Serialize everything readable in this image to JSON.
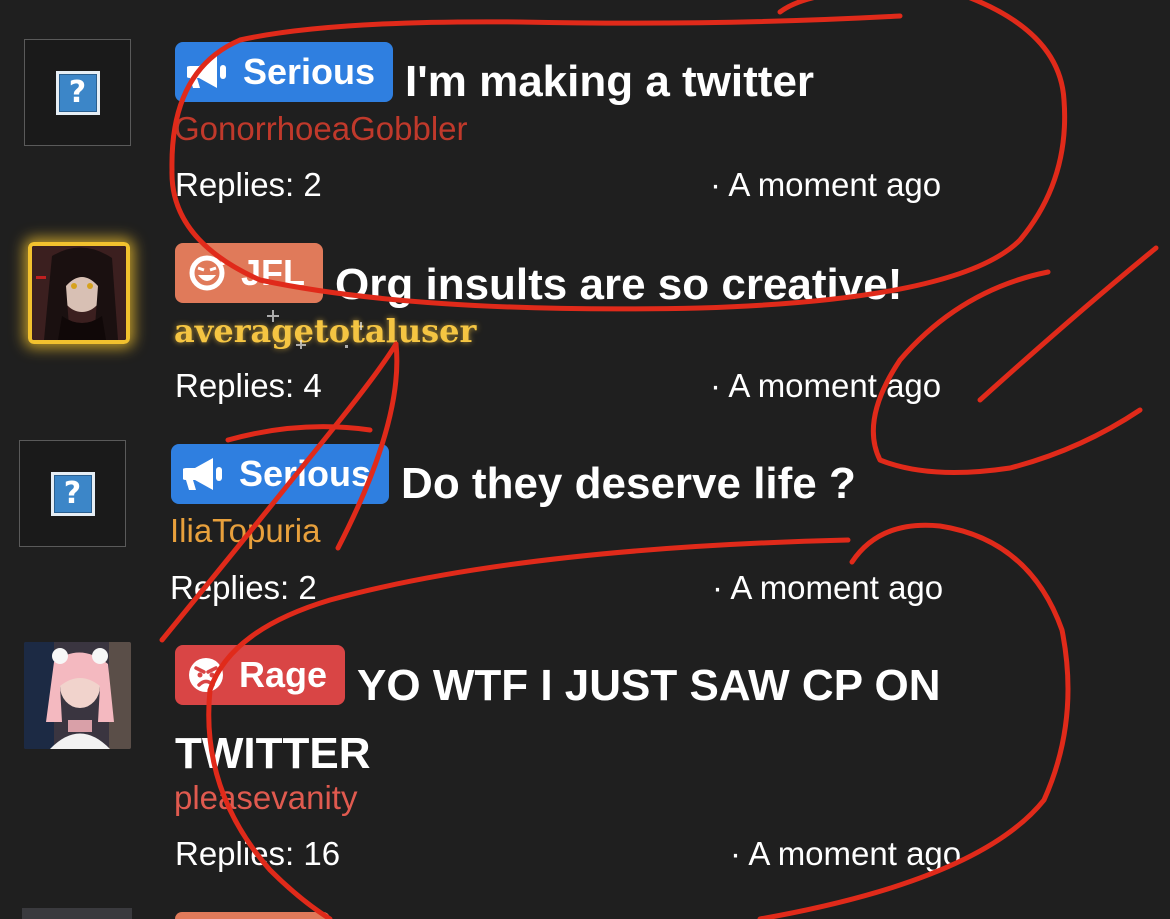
{
  "threads": [
    {
      "tag": "Serious",
      "title": "I'm making a twitter",
      "author": "GonorrhoeaGobbler",
      "author_color": "#c0392b",
      "replies": "Replies: 2",
      "time": "· A moment ago"
    },
    {
      "tag": "JFL",
      "title": "Org insults are so creative!",
      "author": "averagetotaluser",
      "author_color": "#f5c542",
      "replies": "Replies: 4",
      "time": "· A moment ago"
    },
    {
      "tag": "Serious",
      "title": "Do they deserve life ?",
      "author": "IliaTopuria",
      "author_color": "#e8a03c",
      "replies": "Replies: 2",
      "time": "· A moment ago"
    },
    {
      "tag": "Rage",
      "title": "YO WTF I JUST SAW CP ON TWITTER",
      "author": "pleasevanity",
      "author_color": "#e05a4f",
      "replies": "Replies: 16",
      "time": "· A moment ago"
    }
  ],
  "colors": {
    "background": "#1f1f1f",
    "serious_tag": "#2f7fe0",
    "jfl_tag": "#e07a5a",
    "rage_tag": "#d94545",
    "annotation_ink": "#e02a1a"
  },
  "icons": {
    "serious": "megaphone-icon",
    "jfl": "laughing-face-icon",
    "rage": "angry-face-icon",
    "placeholder_avatar": "question-mark-icon"
  }
}
